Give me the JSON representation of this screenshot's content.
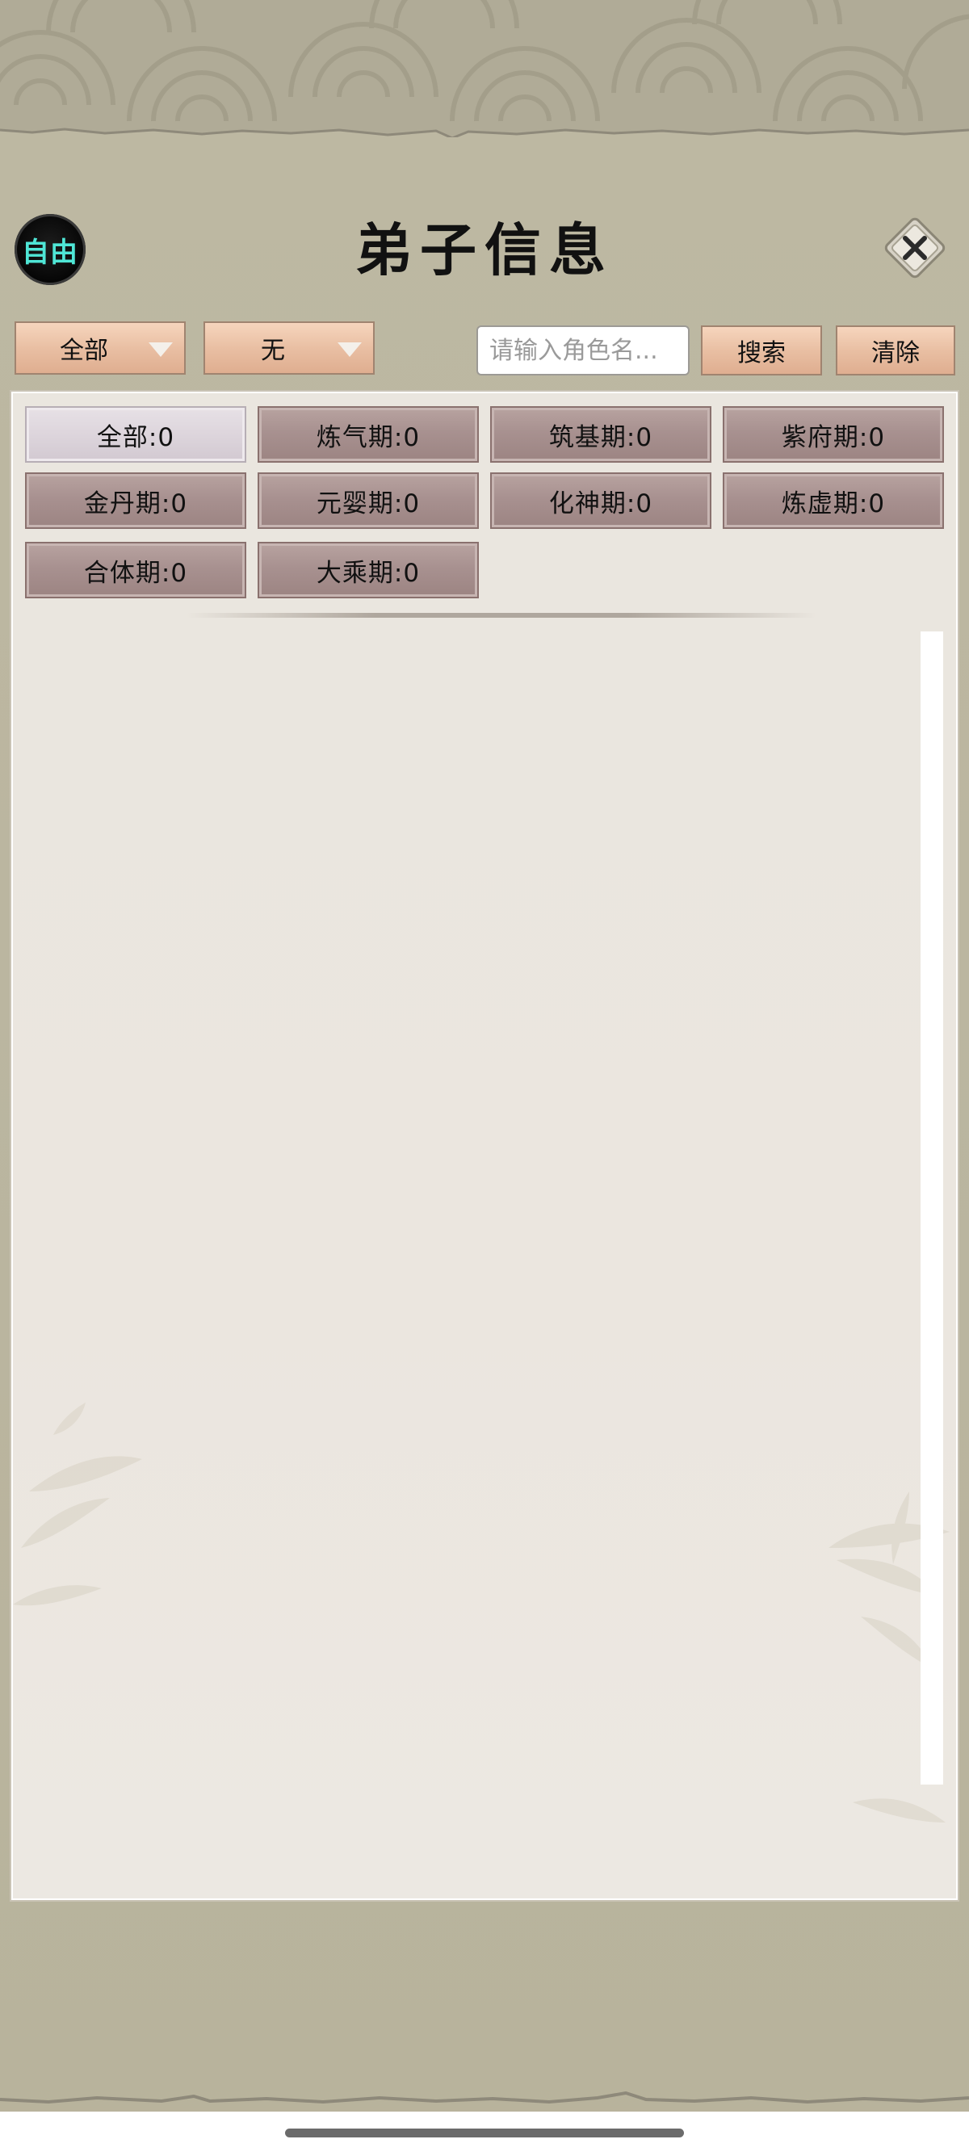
{
  "header": {
    "mode_badge": "自由",
    "title": "弟子信息",
    "close_icon": "close-icon"
  },
  "filters": {
    "scope": {
      "selected": "全部"
    },
    "filter": {
      "selected": "无"
    },
    "search": {
      "placeholder": "请输入角色名...",
      "value": ""
    },
    "search_label": "搜索",
    "clear_label": "清除"
  },
  "stages": [
    {
      "label": "全部:0",
      "active": true
    },
    {
      "label": "炼气期:0",
      "active": false
    },
    {
      "label": "筑基期:0",
      "active": false
    },
    {
      "label": "紫府期:0",
      "active": false
    },
    {
      "label": "金丹期:0",
      "active": false
    },
    {
      "label": "元婴期:0",
      "active": false
    },
    {
      "label": "化神期:0",
      "active": false
    },
    {
      "label": "炼虚期:0",
      "active": false
    },
    {
      "label": "合体期:0",
      "active": false
    },
    {
      "label": "大乘期:0",
      "active": false
    }
  ],
  "colors": {
    "badge_text": "#4fe6d6",
    "button_peach": "#e9bfa3",
    "stage_button": "#a89190",
    "stage_active": "#ddd5dc",
    "panel_bg": "#ebe6df",
    "backdrop": "#b9b39c"
  }
}
